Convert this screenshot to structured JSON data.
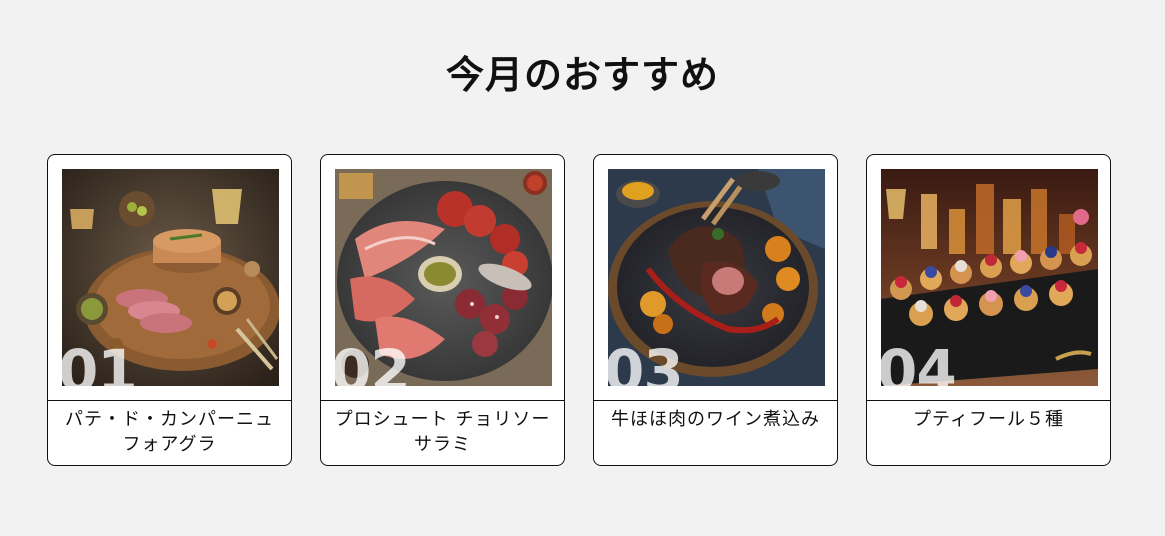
{
  "section": {
    "title": "今月のおすすめ"
  },
  "cards": [
    {
      "number": "01",
      "name": "パテ・ド・カンパーニュ フォアグラ",
      "photo_icon": "pate-foie-gras-platter-photo"
    },
    {
      "number": "02",
      "name": "プロシュート チョリソー サラミ",
      "photo_icon": "charcuterie-board-photo"
    },
    {
      "number": "03",
      "name": "牛ほほ肉のワイン煮込み",
      "photo_icon": "braised-beef-cheek-photo"
    },
    {
      "number": "04",
      "name": "プティフール５種",
      "photo_icon": "petit-four-tray-photo"
    }
  ],
  "colors": {
    "background": "#f2f2f2",
    "card_background": "#ffffff",
    "border": "#111111",
    "number_overlay": "#ffffff"
  }
}
